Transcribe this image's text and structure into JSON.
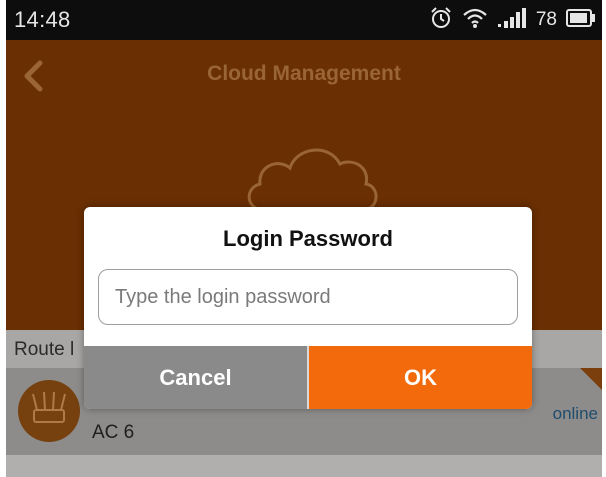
{
  "status_bar": {
    "time": "14:48",
    "battery_level": "78",
    "icons": [
      "alarm-clock-icon",
      "wifi-icon",
      "signal-icon",
      "battery-icon"
    ]
  },
  "header": {
    "title": "Cloud Management",
    "back_icon": "chevron-left-icon",
    "illustration_icon": "cloud-icon"
  },
  "router_list": {
    "section_label": "Route l",
    "items": [
      {
        "name": "AC 6",
        "status": "online"
      }
    ]
  },
  "dialog": {
    "title": "Login Password",
    "password_placeholder": "Type the login password",
    "password_value": "",
    "cancel_label": "Cancel",
    "ok_label": "OK"
  },
  "colors": {
    "header_bg": "#6a2f02",
    "accent": "#f26a0c",
    "cancel_bg": "#8a8a8a",
    "status_bar_bg": "#0d0d0d"
  }
}
